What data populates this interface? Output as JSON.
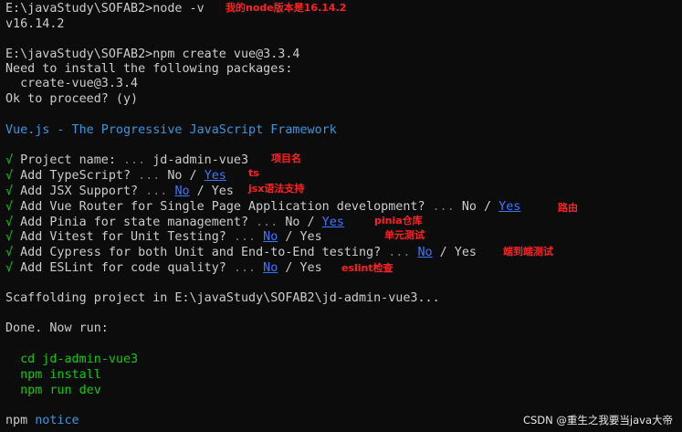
{
  "terminal": {
    "prompt1": "E:\\javaStudy\\SOFAB2>",
    "cmd1": "node -v",
    "node_version": "v16.14.2",
    "prompt2": "E:\\javaStudy\\SOFAB2>",
    "cmd2": "npm create vue@3.3.4",
    "need_install": "Need to install the following packages:",
    "package": "  create-vue@3.3.4",
    "proceed": "Ok to proceed? (y)",
    "framework_banner": "Vue.js - The Progressive JavaScript Framework",
    "check": "√",
    "sep": " / ",
    "dots": " ... ",
    "q_project_name": " Project name:",
    "a_project_name": "jd-admin-vue3",
    "q_typescript": " Add TypeScript?",
    "q_jsx": " Add JSX Support?",
    "q_router": " Add Vue Router for Single Page Application development?",
    "q_pinia": " Add Pinia for state management?",
    "q_vitest": " Add Vitest for Unit Testing?",
    "q_cypress": " Add Cypress for both Unit and End-to-End testing?",
    "q_eslint": " Add ESLint for code quality?",
    "no": "No",
    "yes": "Yes",
    "scaffolding": "Scaffolding project in E:\\javaStudy\\SOFAB2\\jd-admin-vue3...",
    "done": "Done. Now run:",
    "run_cd": "  cd jd-admin-vue3",
    "run_install": "  npm install",
    "run_dev": "  npm run dev",
    "npm_word": "npm",
    "notice_word": "notice"
  },
  "annotations": {
    "node_version_note": "我的node版本是16.14.2",
    "project_name_note": "项目名",
    "ts_note": "ts",
    "jsx_note": "jsx语法支持",
    "router_note": "路由",
    "pinia_note": "pinia仓库",
    "vitest_note": "单元测试",
    "cypress_note": "端到端测试",
    "eslint_note": "eslint检查"
  },
  "watermark": "CSDN @重生之我要当java大帝",
  "colors": {
    "background": "#0c0c0c",
    "text": "#cccccc",
    "muted": "#767676",
    "cyan": "#3a96dd",
    "green": "#16c60c",
    "link": "#3b78ff",
    "annotation": "#ff2222"
  }
}
